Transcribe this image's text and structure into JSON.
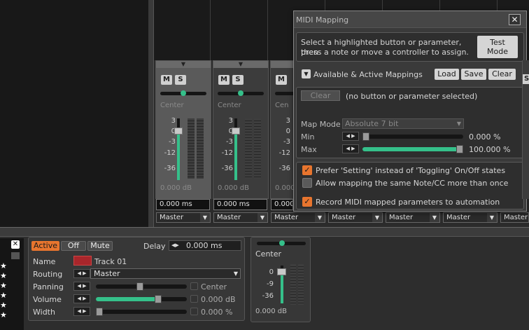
{
  "mixer": {
    "mute": "M",
    "solo": "S",
    "scale": [
      "3",
      "0",
      "-3",
      "-12",
      "-36"
    ],
    "route": "Master",
    "strips": [
      {
        "pan": "Center",
        "db": "0.000 dB",
        "ms": "0.000 ms"
      },
      {
        "pan": "Center",
        "db": "0.000 dB",
        "ms": "0.000 ms"
      },
      {
        "pan": "Cen",
        "db": "0.000",
        "ms": "0.000"
      }
    ]
  },
  "track": {
    "active_label": "Active",
    "off_label": "Off",
    "mute_label": "Mute",
    "delay_label": "Delay",
    "delay_value": "0.000 ms",
    "name_label": "Name",
    "name": "Track 01",
    "routing_label": "Routing",
    "routing": "Master",
    "panning_label": "Panning",
    "panning": "Center",
    "volume_label": "Volume",
    "volume": "0.000 dB",
    "width_label": "Width",
    "width": "0.000 %"
  },
  "mini": {
    "pan": "Center",
    "scale": [
      "0",
      "-9",
      "-36"
    ],
    "db": "0.000 dB"
  },
  "dialog": {
    "title": "MIDI Mapping",
    "instructions_1": "Select a highlighted button or parameter, then",
    "instructions_2": "press a note or move a controller to assign.",
    "test_label_1": "Test",
    "test_label_2": "Mode",
    "mappings_label": "Available & Active Mappings",
    "load": "Load",
    "save": "Save",
    "clear": "Clear",
    "selection_status": "(no button or parameter selected)",
    "map_mode_label": "Map Mode",
    "map_mode": "Absolute 7 bit",
    "min_label": "Min",
    "min_value": "0.000 %",
    "max_label": "Max",
    "max_value": "100.000 %",
    "opt_prefer": "Prefer 'Setting' instead of 'Toggling' On/Off states",
    "opt_allow": "Allow mapping the same Note/CC more than once",
    "opt_record": "Record MIDI mapped parameters to automation"
  }
}
